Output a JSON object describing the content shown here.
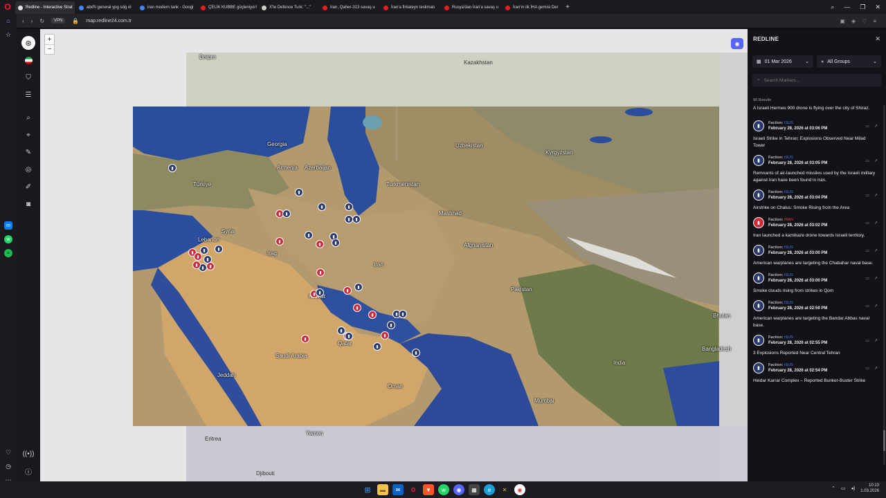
{
  "browser": {
    "tabs": [
      {
        "title": "Redline - Interactive Strat",
        "color": "#e0e0e0",
        "active": true
      },
      {
        "title": "abd'li general ypg sdg ol",
        "color": "#4285f4",
        "active": false
      },
      {
        "title": "iran modern tank - Googl",
        "color": "#4285f4",
        "active": false
      },
      {
        "title": "ÇELİK KUBBE güçleniyor!",
        "color": "#e02020",
        "active": false
      },
      {
        "title": "X'te Defence Turk: \"...\"",
        "color": "#cccccc",
        "active": false
      },
      {
        "title": "Iran, Qaher-313 savaş u",
        "color": "#e02020",
        "active": false
      },
      {
        "title": "İran'a firkateyn teslimatı",
        "color": "#e02020",
        "active": false
      },
      {
        "title": "Rusya'dan İran'a savaş u",
        "color": "#e02020",
        "active": false
      },
      {
        "title": "İran'ın ilk İHA gemisi Der",
        "color": "#e02020",
        "active": false
      }
    ],
    "url": "map.redline24.com.tr",
    "vpn_label": "VPN",
    "new_tab": "+"
  },
  "map": {
    "zoom_in": "+",
    "zoom_out": "−",
    "places": [
      {
        "name": "Kazakhstan",
        "cls": "dark"
      },
      {
        "name": "Uzbekistan"
      },
      {
        "name": "Kyrgyzstan"
      },
      {
        "name": "Georgia"
      },
      {
        "name": "Armenia"
      },
      {
        "name": "Azerbaijan"
      },
      {
        "name": "Turkmenistan"
      },
      {
        "name": "Türkiye"
      },
      {
        "name": "Syria"
      },
      {
        "name": "Lebanon"
      },
      {
        "name": "Iraq"
      },
      {
        "name": "Iran"
      },
      {
        "name": "Afghanistan"
      },
      {
        "name": "Pakistan"
      },
      {
        "name": "India"
      },
      {
        "name": "Kuwait"
      },
      {
        "name": "Qatar"
      },
      {
        "name": "Saudi Arabia"
      },
      {
        "name": "Oman"
      },
      {
        "name": "Yemen"
      },
      {
        "name": "Eritrea",
        "cls": "dark"
      },
      {
        "name": "Djibouti",
        "cls": "dark"
      },
      {
        "name": "Bhutan"
      },
      {
        "name": "Bangladesh"
      },
      {
        "name": "Jeddah"
      },
      {
        "name": "Mumbai"
      },
      {
        "name": "Mashhad"
      },
      {
        "name": "Dnipro"
      }
    ],
    "markers": [
      {
        "c": "blue"
      },
      {
        "c": "blue"
      },
      {
        "c": "red"
      },
      {
        "c": "blue"
      },
      {
        "c": "blue"
      },
      {
        "c": "blue"
      },
      {
        "c": "blue"
      },
      {
        "c": "blue"
      },
      {
        "c": "blue"
      },
      {
        "c": "red"
      },
      {
        "c": "blue"
      },
      {
        "c": "blue"
      },
      {
        "c": "red"
      },
      {
        "c": "red"
      },
      {
        "c": "red"
      },
      {
        "c": "blue"
      },
      {
        "c": "blue"
      },
      {
        "c": "blue"
      },
      {
        "c": "red"
      },
      {
        "c": "red"
      },
      {
        "c": "blue"
      },
      {
        "c": "red"
      },
      {
        "c": "red"
      },
      {
        "c": "red"
      },
      {
        "c": "blue"
      },
      {
        "c": "blue"
      },
      {
        "c": "red"
      },
      {
        "c": "red"
      },
      {
        "c": "blue"
      },
      {
        "c": "blue"
      },
      {
        "c": "blue"
      },
      {
        "c": "blue"
      },
      {
        "c": "red"
      },
      {
        "c": "blue"
      },
      {
        "c": "red"
      },
      {
        "c": "blue"
      },
      {
        "c": "red"
      },
      {
        "c": "blue"
      }
    ]
  },
  "panel": {
    "title": "REDLINE",
    "date": "01 Mar 2026",
    "group": "All Groups",
    "search_placeholder": "Search Markers...",
    "results": "90 Results",
    "first_text": "A Israeli Hermes 900 drone is flying over the city of Shiraz.",
    "faction_label": "Faction:",
    "items": [
      {
        "faction": "ISUS",
        "red": false,
        "date": "February 28, 2026 at 03:06 PM",
        "text": "Israeli Strike in Tehran: Explosions Observed Near Milad Tower"
      },
      {
        "faction": "ISUS",
        "red": false,
        "date": "February 28, 2026 at 03:05 PM",
        "text": "Remnants of air-launched missiles used by the Israeli military against Iran have been found in Iran."
      },
      {
        "faction": "ISUS",
        "red": false,
        "date": "February 28, 2026 at 03:04 PM",
        "text": "Airstrike on Chalus: Smoke Rising from the Area"
      },
      {
        "faction": "IRAN",
        "red": true,
        "date": "February 28, 2026 at 03:02 PM",
        "text": "Iran launched a kamikaze drone towards Israeli territory."
      },
      {
        "faction": "ISUS",
        "red": false,
        "date": "February 28, 2026 at 03:00 PM",
        "text": "American warplanes are targeting the Chabahar naval base."
      },
      {
        "faction": "ISUS",
        "red": false,
        "date": "February 28, 2026 at 03:00 PM",
        "text": "Smoke clouds rising from strikes in Qom"
      },
      {
        "faction": "ISUS",
        "red": false,
        "date": "February 28, 2026 at 02:59 PM",
        "text": "American warplanes are targeting the Bandar Abbas naval base."
      },
      {
        "faction": "ISUS",
        "red": false,
        "date": "February 28, 2026 at 02:55 PM",
        "text": "3 Explosions Reported Near Central Tehran"
      },
      {
        "faction": "ISUS",
        "red": false,
        "date": "February 28, 2026 at 02:54 PM",
        "text": "Heidar Karrar Complex – Reported Bunker-Buster Strike"
      }
    ]
  },
  "taskbar": {
    "time": "10:13",
    "date": "1.03.2026"
  }
}
